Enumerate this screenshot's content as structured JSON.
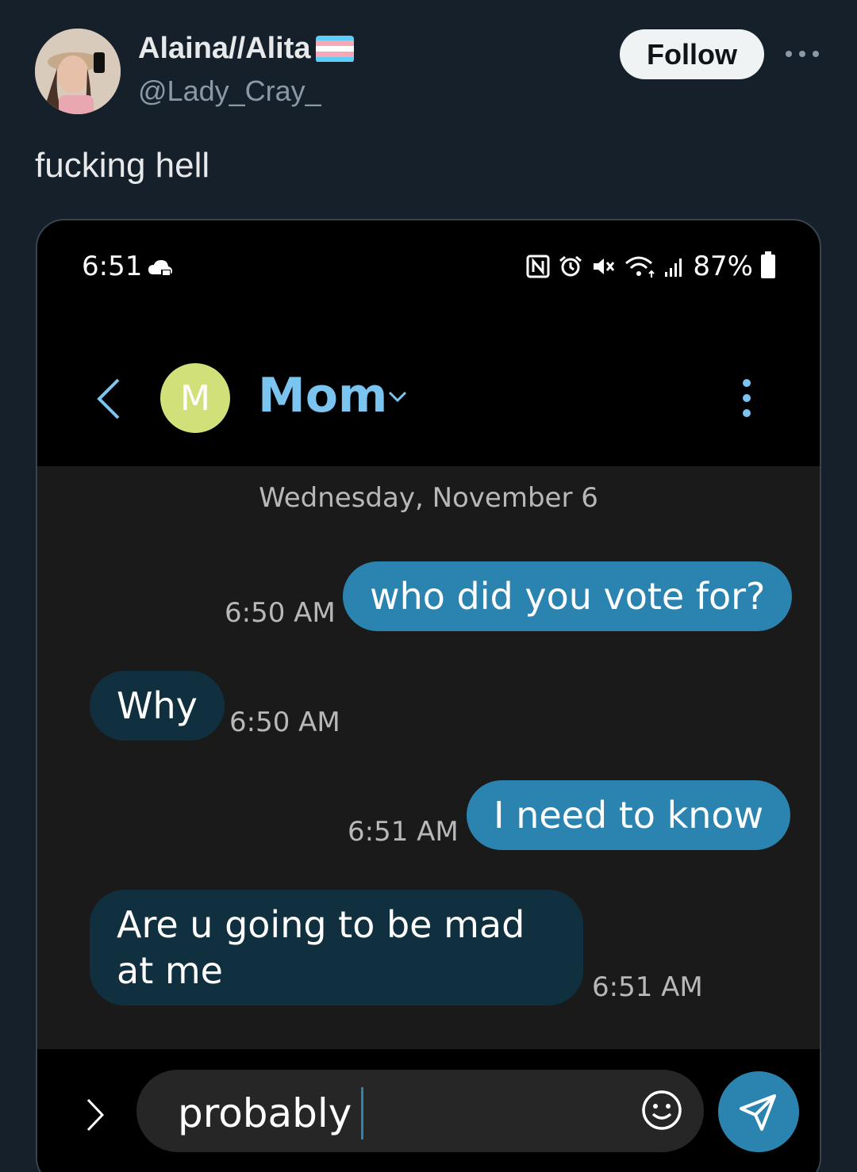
{
  "tweet": {
    "author": {
      "display_name": "Alaina//Alita",
      "handle": "@Lady_Cray_",
      "flag_icon": "transgender-flag-icon"
    },
    "follow_label": "Follow",
    "more_icon": "more-horizontal-icon",
    "text": "fucking hell"
  },
  "phone": {
    "status_bar": {
      "time": "6:51",
      "battery": "87%",
      "icons": [
        "cloud-icon",
        "nfc-icon",
        "alarm-icon",
        "mute-icon",
        "wifi-icon",
        "signal-icon",
        "battery-icon"
      ]
    },
    "header": {
      "contact_initial": "M",
      "contact_name": "Mom",
      "avatar_color": "#d2e07a",
      "accent": "#7cc4f0"
    },
    "conversation": {
      "date": "Wednesday, November 6",
      "messages": [
        {
          "direction": "outgoing",
          "text": "who did you vote for?",
          "time": "6:50 AM"
        },
        {
          "direction": "incoming",
          "text": "Why",
          "time": "6:50 AM"
        },
        {
          "direction": "outgoing",
          "text": "I need to know",
          "time": "6:51 AM"
        },
        {
          "direction": "incoming",
          "text": "Are u going to be mad at me",
          "time": "6:51 AM"
        }
      ]
    },
    "composer": {
      "draft": "probably"
    },
    "colors": {
      "outgoing_bubble": "#2b84b0",
      "incoming_bubble": "#10303f"
    }
  }
}
